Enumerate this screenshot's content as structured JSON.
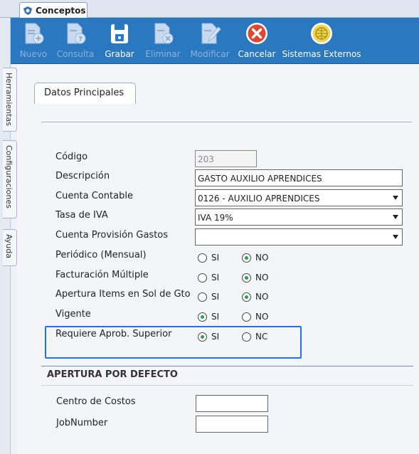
{
  "window": {
    "tab_title": "Conceptos"
  },
  "toolbar": {
    "buttons": [
      {
        "label": "Nuevo",
        "icon": "new-document-icon",
        "enabled": false
      },
      {
        "label": "Consulta",
        "icon": "query-document-icon",
        "enabled": false
      },
      {
        "label": "Grabar",
        "icon": "save-icon",
        "enabled": true
      },
      {
        "label": "Eliminar",
        "icon": "delete-document-icon",
        "enabled": false
      },
      {
        "label": "Modificar",
        "icon": "edit-document-icon",
        "enabled": false
      },
      {
        "label": "Cancelar",
        "icon": "cancel-icon",
        "enabled": true
      },
      {
        "label": "Sistemas Externos",
        "icon": "external-systems-icon",
        "enabled": true
      }
    ],
    "colors": {
      "bar": "#2a78c0",
      "disabled_text": "#8fb1d6",
      "enabled_text": "#ffffff"
    }
  },
  "side_tabs": [
    "Herramientas",
    "Configuraciones",
    "Ayuda"
  ],
  "form": {
    "tab_label": "Datos Principales",
    "codigo": {
      "label": "Código",
      "value": "203"
    },
    "descripcion": {
      "label": "Descripción",
      "value": "GASTO AUXILIO APRENDICES"
    },
    "cuenta_contable": {
      "label": "Cuenta Contable",
      "value": "0126 - AUXILIO APRENDICES"
    },
    "tasa_iva": {
      "label": "Tasa de IVA",
      "value": "IVA 19%"
    },
    "cuenta_provision": {
      "label": "Cuenta Provisión Gastos",
      "value": ""
    },
    "periodico": {
      "label": "Periódico (Mensual)",
      "si": "SI",
      "no": "NO",
      "selected": "no"
    },
    "facturacion_multiple": {
      "label": "Facturación Múltiple",
      "si": "SI",
      "no": "NO",
      "selected": "no"
    },
    "apertura_items": {
      "label": "Apertura Items en Sol de Gto",
      "si": "SI",
      "no": "NO",
      "selected": "no"
    },
    "vigente": {
      "label": "Vigente",
      "si": "SI",
      "no": "NO",
      "selected": "si"
    },
    "requiere_aprob": {
      "label": "Requiere Aprob. Superior",
      "si": "SI",
      "no": "NC",
      "selected": "si"
    }
  },
  "apertura": {
    "title": "APERTURA POR DEFECTO",
    "centro_costos": {
      "label": "Centro de Costos",
      "value": ""
    },
    "jobnumber": {
      "label": "JobNumber",
      "value": ""
    }
  },
  "accent": {
    "highlight_border": "#2374d8",
    "radio_selected": "#2aa148"
  }
}
